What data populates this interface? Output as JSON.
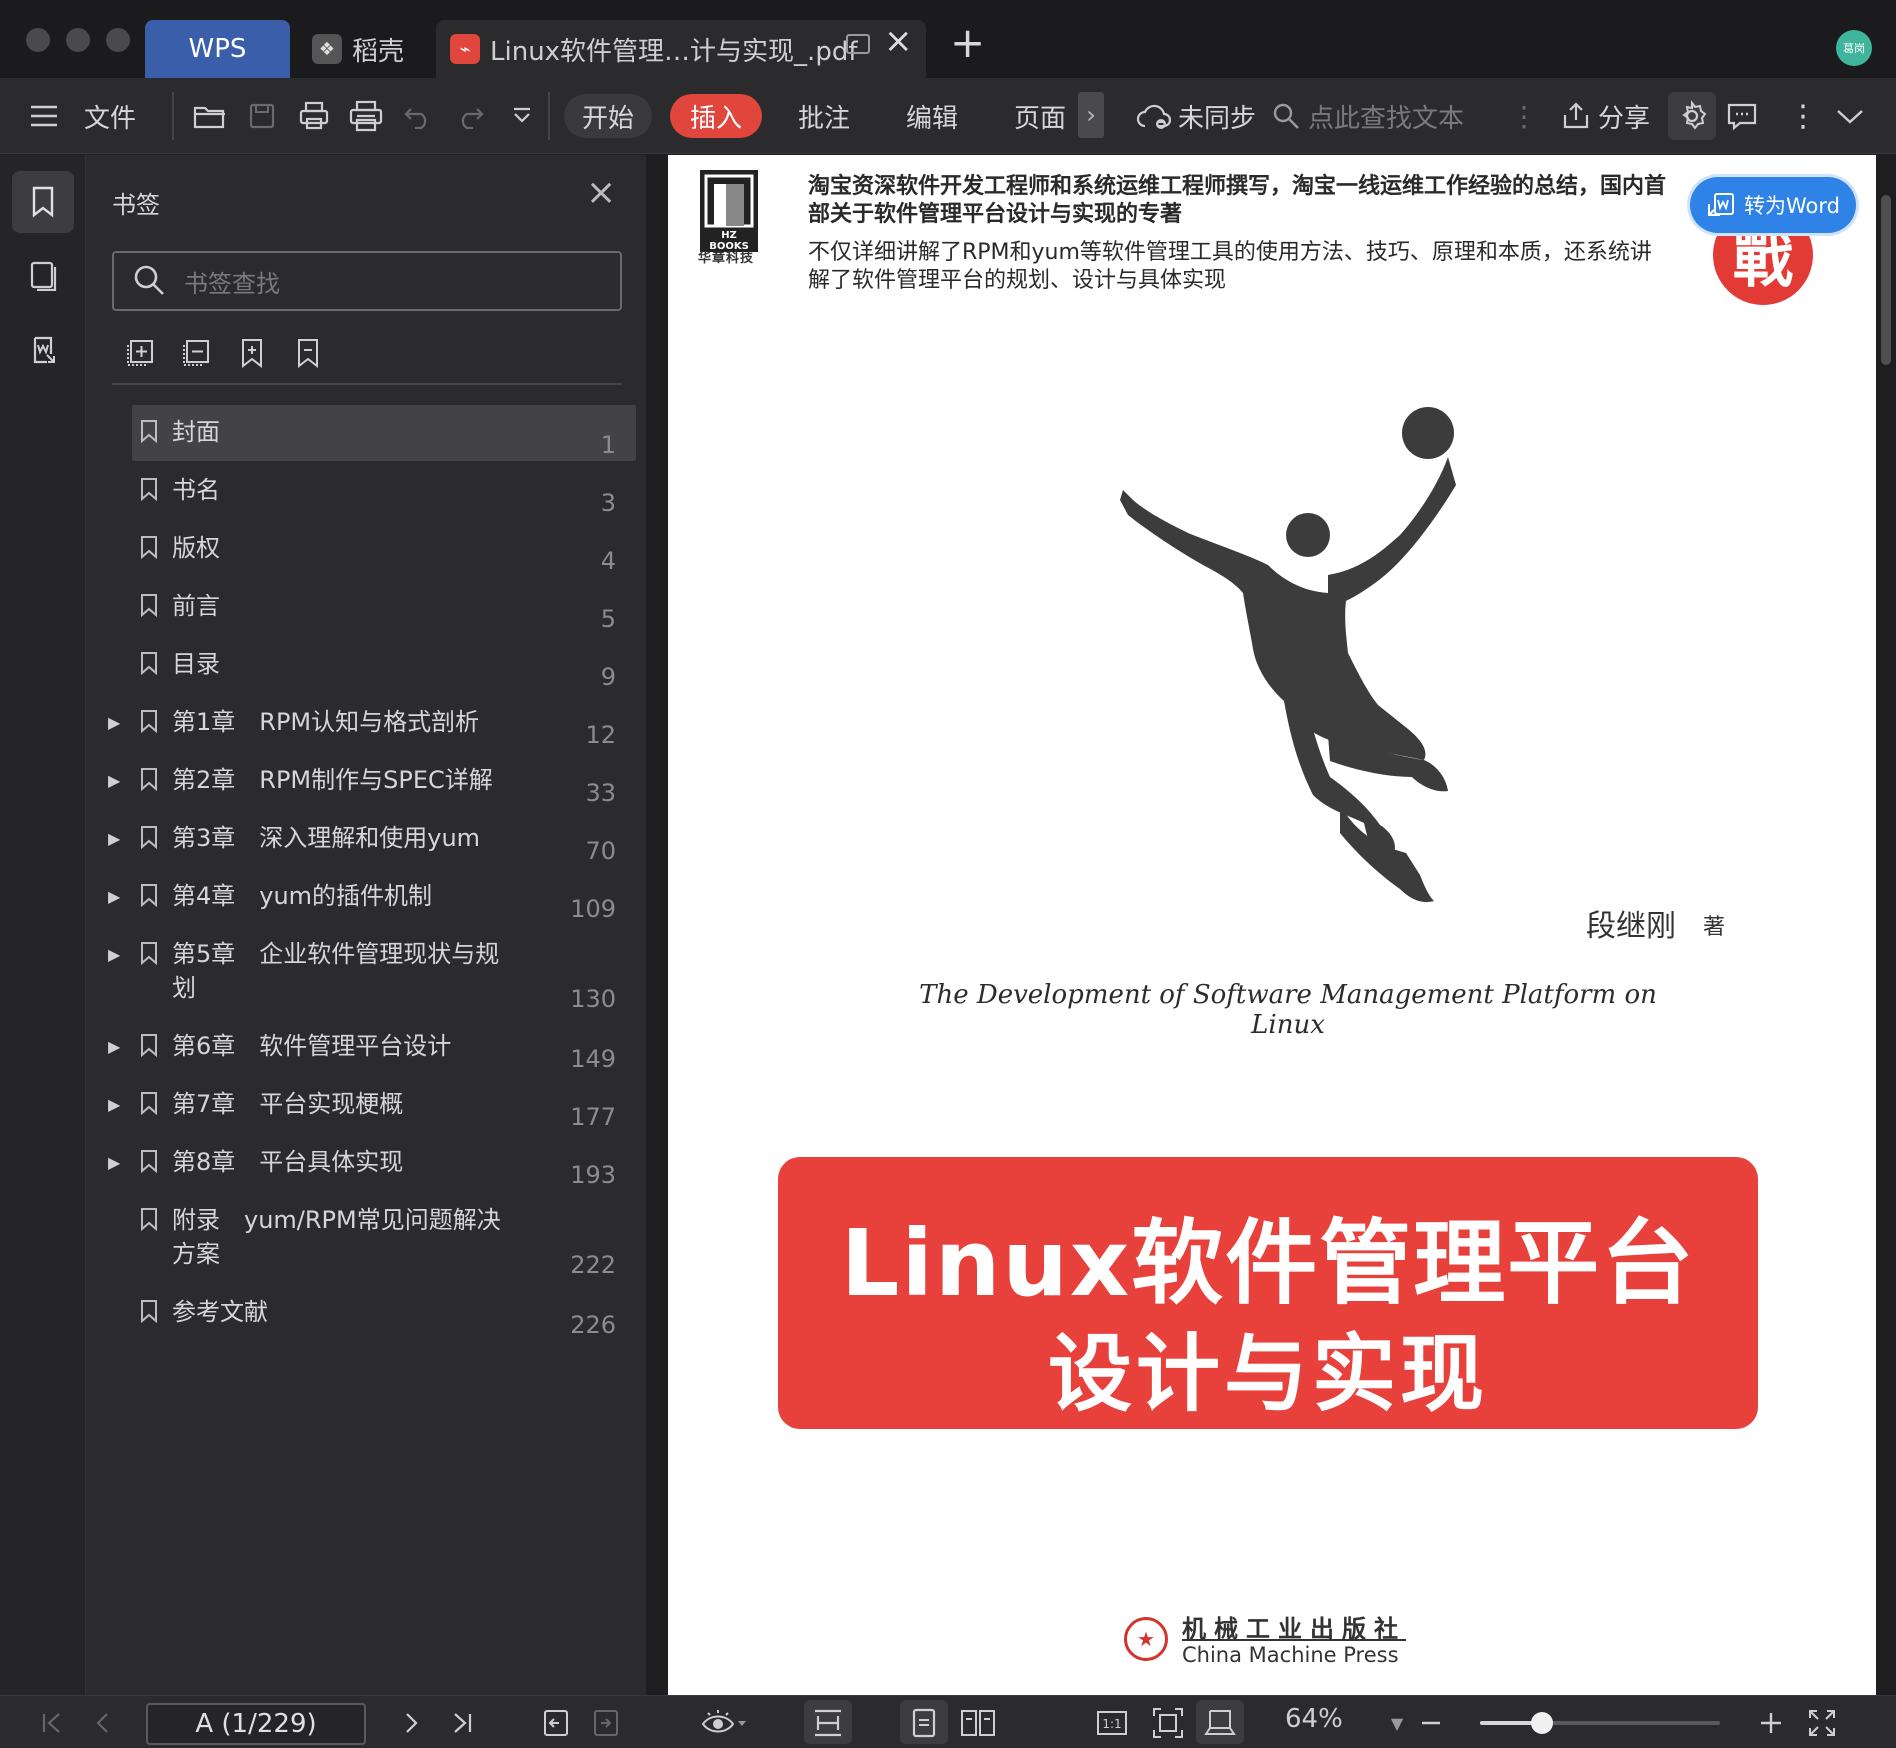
{
  "titlebar": {
    "tabs": [
      {
        "label": "WPS"
      },
      {
        "label": "稻壳"
      },
      {
        "label": "Linux软件管理…计与实现_.pdf"
      }
    ],
    "avatar_text": "葛岗"
  },
  "toolbar": {
    "file_label": "文件",
    "menu": [
      "开始",
      "插入",
      "批注",
      "编辑",
      "页面"
    ],
    "active_menu": "插入",
    "sync_label": "未同步",
    "search_placeholder": "点此查找文本",
    "share_label": "分享"
  },
  "bookmarks": {
    "title": "书签",
    "search_placeholder": "书签查找",
    "items": [
      {
        "label": "封面",
        "page": "1",
        "expandable": false,
        "selected": true
      },
      {
        "label": "书名",
        "page": "3",
        "expandable": false
      },
      {
        "label": "版权",
        "page": "4",
        "expandable": false
      },
      {
        "label": "前言",
        "page": "5",
        "expandable": false
      },
      {
        "label": "目录",
        "page": "9",
        "expandable": false
      },
      {
        "label": "第1章　RPM认知与格式剖析",
        "page": "12",
        "expandable": true
      },
      {
        "label": "第2章　RPM制作与SPEC详解",
        "page": "33",
        "expandable": true
      },
      {
        "label": "第3章　深入理解和使用yum",
        "page": "70",
        "expandable": true
      },
      {
        "label": "第4章　yum的插件机制",
        "page": "109",
        "expandable": true
      },
      {
        "label": "第5章　企业软件管理现状与规划",
        "page": "130",
        "expandable": true
      },
      {
        "label": "第6章　软件管理平台设计",
        "page": "149",
        "expandable": true
      },
      {
        "label": "第7章　平台实现梗概",
        "page": "177",
        "expandable": true
      },
      {
        "label": "第8章　平台具体实现",
        "page": "193",
        "expandable": true
      },
      {
        "label": "附录　yum/RPM常见问题解决方案",
        "page": "222",
        "expandable": false
      },
      {
        "label": "参考文献",
        "page": "226",
        "expandable": false
      }
    ]
  },
  "document": {
    "publisher_logo": {
      "brand": "HZ BOOKS",
      "cn": "华章科技"
    },
    "blurb_bold": "淘宝资深软件开发工程师和系统运维工程师撰写，淘宝一线运维工作经验的总结，国内首部关于软件管理平台设计与实现的专著",
    "blurb": "不仅详细讲解了RPM和yum等软件管理工具的使用方法、技巧、原理和本质，还系统讲解了软件管理平台的规划、设计与具体实现",
    "seal_text": "戰",
    "to_word_label": "转为Word",
    "author": "段继刚",
    "author_suffix": "著",
    "english_title": "The Development of Software Management Platform on Linux",
    "title_line1": "Linux软件管理平台",
    "title_line2": "设计与实现",
    "publisher_cn": "机械工业出版社",
    "publisher_en": "China Machine Press"
  },
  "statusbar": {
    "page_indicator": "A (1/229)",
    "zoom": "64%",
    "zoom_fraction": 0.26
  },
  "colors": {
    "accent_red": "#e0463c",
    "wps_blue": "#3b5eaa",
    "word_blue": "#2f83e6"
  }
}
